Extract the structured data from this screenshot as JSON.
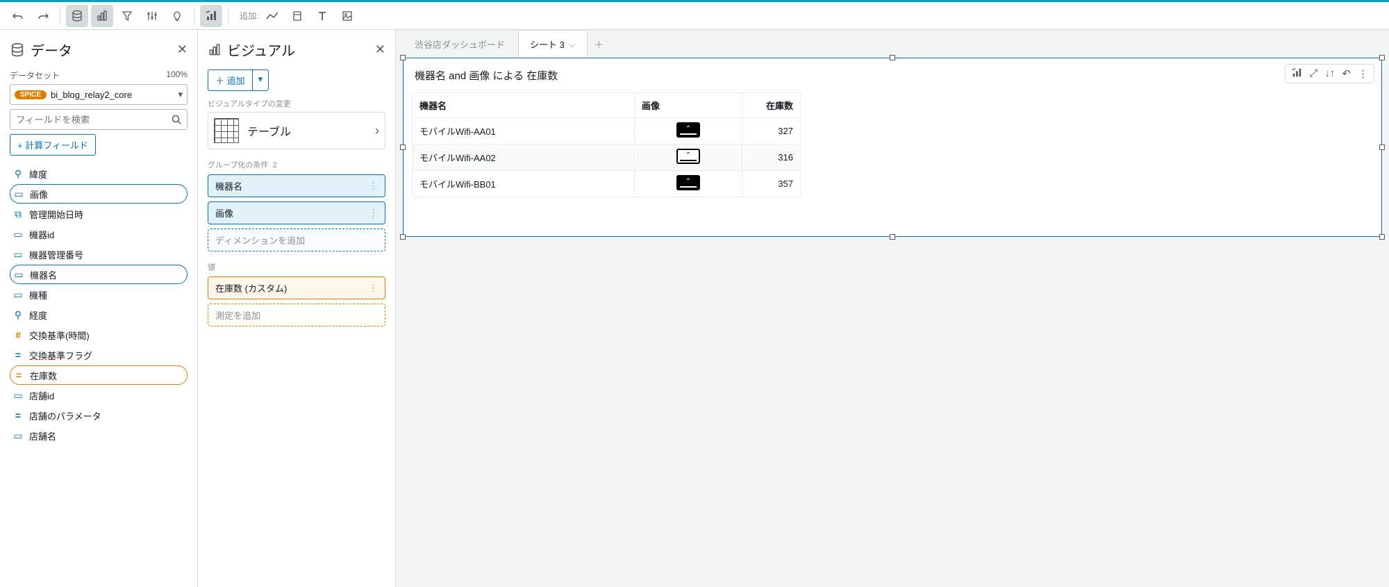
{
  "toolbar": {
    "add_label": "追加:"
  },
  "data_panel": {
    "title": "データ",
    "dataset_label": "データセット",
    "percent": "100%",
    "spice": "SPICE",
    "dataset_name": "bi_blog_relay2_core",
    "search_placeholder": "フィールドを検索",
    "calc_field_btn": "+ 計算フィールド",
    "fields": {
      "f0": "緯度",
      "f1": "画像",
      "f2": "管理開始日時",
      "f3": "機器id",
      "f4": "機器管理番号",
      "f5": "機器名",
      "f6": "機種",
      "f7": "経度",
      "f8": "交換基準(時間)",
      "f9": "交換基準フラグ",
      "f10": "在庫数",
      "f11": "店舗id",
      "f12": "店舗のパラメータ",
      "f13": "店舗名"
    }
  },
  "visual_panel": {
    "title": "ビジュアル",
    "add_btn": "追加",
    "change_type_label": "ビジュアルタイプの変更",
    "type_name": "テーブル",
    "group_label": "グループ化の条件",
    "group_count": "2",
    "dim1": "機器名",
    "dim2": "画像",
    "dim_placeholder": "ディメンションを追加",
    "value_label": "値",
    "meas1": "在庫数 (カスタム)",
    "meas_placeholder": "測定を追加"
  },
  "tabs": {
    "tab1": "渋谷店ダッシュボード",
    "tab2": "シート 3"
  },
  "visual": {
    "title": "機器名 and 画像 による 在庫数",
    "col1": "機器名",
    "col2": "画像",
    "col3": "在庫数",
    "r1c1": "モバイルWifi-AA01",
    "r1c3": "327",
    "r2c1": "モバイルWifi-AA02",
    "r2c3": "316",
    "r3c1": "モバイルWifi-BB01",
    "r3c3": "357"
  },
  "chart_data": {
    "type": "table",
    "title": "機器名 and 画像 による 在庫数",
    "columns": [
      "機器名",
      "画像",
      "在庫数"
    ],
    "rows": [
      {
        "機器名": "モバイルWifi-AA01",
        "画像": "wifi-dark",
        "在庫数": 327
      },
      {
        "機器名": "モバイルWifi-AA02",
        "画像": "wifi-light",
        "在庫数": 316
      },
      {
        "機器名": "モバイルWifi-BB01",
        "画像": "wifi-dark",
        "在庫数": 357
      }
    ]
  }
}
